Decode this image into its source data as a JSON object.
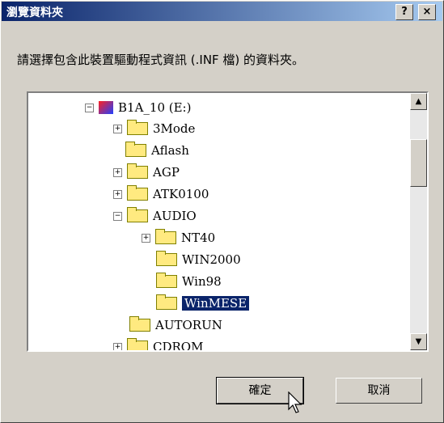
{
  "window": {
    "title": "瀏覽資料夾",
    "help_label": "?",
    "close_label": "×"
  },
  "prompt": "請選擇包含此裝置驅動程式資訊 (.INF 檔) 的資料夾。",
  "tree": {
    "items": [
      {
        "label": "B1A_10 (E:)",
        "expander": "−",
        "icon": "drive-icon",
        "selected": false
      },
      {
        "label": "3Mode",
        "expander": "+",
        "icon": "folder-icon",
        "selected": false
      },
      {
        "label": "Aflash",
        "expander": "",
        "icon": "folder-icon",
        "selected": false
      },
      {
        "label": "AGP",
        "expander": "+",
        "icon": "folder-icon",
        "selected": false
      },
      {
        "label": "ATK0100",
        "expander": "+",
        "icon": "folder-icon",
        "selected": false
      },
      {
        "label": "AUDIO",
        "expander": "−",
        "icon": "folder-icon",
        "selected": false
      },
      {
        "label": "NT40",
        "expander": "+",
        "icon": "folder-icon",
        "selected": false
      },
      {
        "label": "WIN2000",
        "expander": "",
        "icon": "folder-icon",
        "selected": false
      },
      {
        "label": "Win98",
        "expander": "",
        "icon": "folder-icon",
        "selected": false
      },
      {
        "label": "WinMESE",
        "expander": "",
        "icon": "folder-open-icon",
        "selected": true
      },
      {
        "label": "AUTORUN",
        "expander": "",
        "icon": "folder-icon",
        "selected": false
      },
      {
        "label": "CDROM",
        "expander": "+",
        "icon": "folder-icon",
        "selected": false
      }
    ]
  },
  "buttons": {
    "ok_label": "確定",
    "cancel_label": "取消"
  },
  "colors": {
    "titlebar_start": "#0a246a",
    "titlebar_end": "#a6caf0",
    "selection": "#0a246a"
  }
}
